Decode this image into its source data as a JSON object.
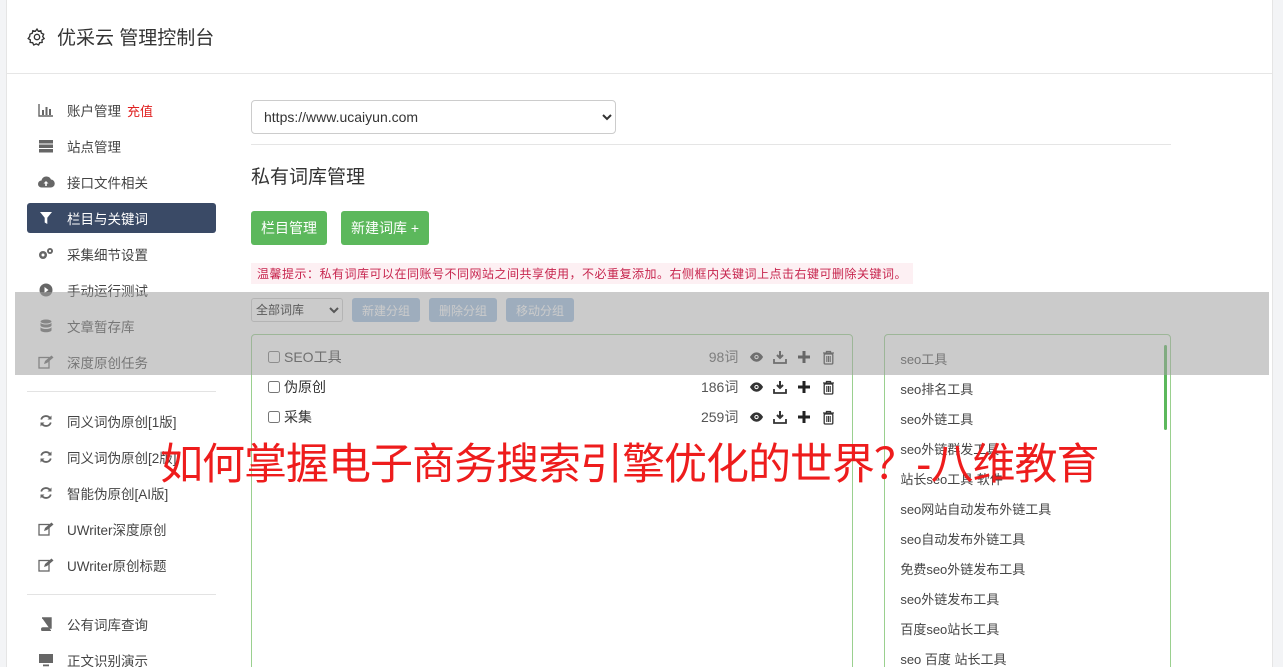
{
  "header": {
    "title": "优采云 管理控制台",
    "icon": "gear-icon"
  },
  "sidebar": {
    "groups": [
      [
        {
          "label": "账户管理",
          "badge": "充值",
          "icon": "bar-chart-icon"
        },
        {
          "label": "站点管理",
          "icon": "server-icon"
        },
        {
          "label": "接口文件相关",
          "icon": "cloud-upload-icon"
        },
        {
          "label": "栏目与关键词",
          "icon": "filter-icon",
          "active": true
        },
        {
          "label": "采集细节设置",
          "icon": "cogs-icon"
        },
        {
          "label": "手动运行测试",
          "icon": "play-icon"
        },
        {
          "label": "文章暂存库",
          "icon": "database-icon"
        },
        {
          "label": "深度原创任务",
          "icon": "edit-icon"
        }
      ],
      [
        {
          "label": "同义词伪原创[1版]",
          "icon": "refresh-icon"
        },
        {
          "label": "同义词伪原创[2版]",
          "icon": "refresh-icon"
        },
        {
          "label": "智能伪原创[AI版]",
          "icon": "refresh-icon"
        },
        {
          "label": "UWriter深度原创",
          "icon": "edit-icon"
        },
        {
          "label": "UWriter原创标题",
          "icon": "edit-icon"
        }
      ],
      [
        {
          "label": "公有词库查询",
          "icon": "book-icon"
        },
        {
          "label": "正文识别演示",
          "icon": "monitor-icon"
        }
      ]
    ]
  },
  "main": {
    "site_select": "https://www.ucaiyun.com",
    "section_title": "私有词库管理",
    "buttons": {
      "column_manage": "栏目管理",
      "new_library": "新建词库 +"
    },
    "tip": "温馨提示：私有词库可以在同账号不同网站之间共享使用，不必重复添加。右侧框内关键词上点击右键可删除关键词。",
    "group_select": "全部词库",
    "group_buttons": {
      "new_group": "新建分组",
      "delete_group": "删除分组",
      "move_group": "移动分组"
    },
    "libraries": [
      {
        "name": "SEO工具",
        "count": "98词"
      },
      {
        "name": "伪原创",
        "count": "186词"
      },
      {
        "name": "采集",
        "count": "259词"
      }
    ],
    "keywords": [
      "seo工具",
      "seo排名工具",
      "seo外链工具",
      "seo外链群发工具",
      "站长seo工具 软件",
      "seo网站自动发布外链工具",
      "seo自动发布外链工具",
      "免费seo外链发布工具",
      "seo外链发布工具",
      "百度seo站长工具",
      "seo 百度 站长工具"
    ]
  },
  "overlay": {
    "caption": "如何掌握电子商务搜索引擎优化的世界？-八维教育"
  },
  "colors": {
    "accent_green": "#5cb85c",
    "active_nav": "#3a4a66",
    "caption_red": "#ee1c1c",
    "light_blue_button": "#9bbde0"
  }
}
